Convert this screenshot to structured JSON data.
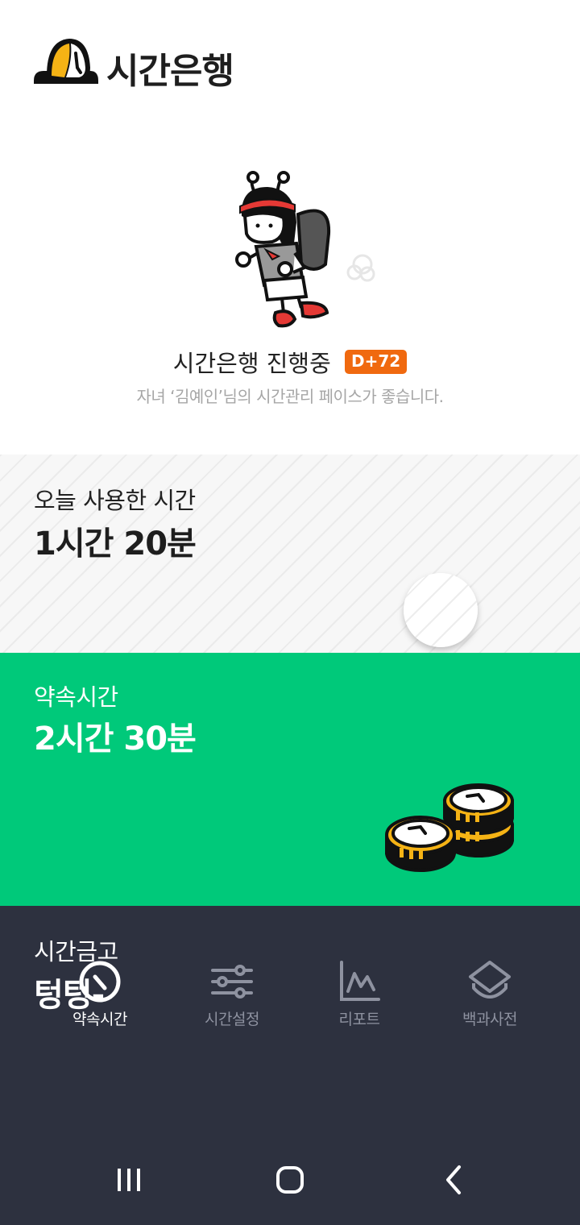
{
  "header": {
    "app_title": "시간은행",
    "logo_icon": "coin-logo-icon"
  },
  "status": {
    "title": "시간은행 진행중",
    "dday": "D+72",
    "subtitle": "자녀 ‘김예인’님의 시간관리 페이스가 좋습니다."
  },
  "today_used": {
    "label": "오늘 사용한 시간",
    "value": "1시간 20분"
  },
  "promise": {
    "label": "약속시간",
    "value": "2시간 30분"
  },
  "vault": {
    "label": "시간금고",
    "value": "텅텅-"
  },
  "nav": {
    "items": [
      {
        "label": "약속시간",
        "icon": "clock-icon",
        "active": true
      },
      {
        "label": "시간설정",
        "icon": "sliders-icon",
        "active": false
      },
      {
        "label": "리포트",
        "icon": "chart-icon",
        "active": false
      },
      {
        "label": "백과사전",
        "icon": "book-icon",
        "active": false
      }
    ]
  },
  "colors": {
    "accent_green": "#00c97a",
    "badge_orange": "#f0690f",
    "dark_bg": "#2d313f",
    "coin_yellow": "#f5b315"
  }
}
